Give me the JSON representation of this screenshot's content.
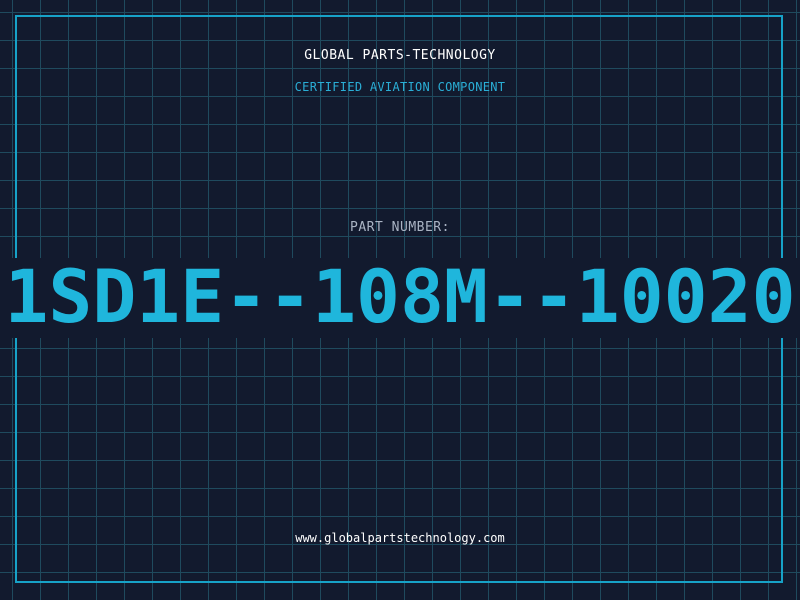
{
  "header": {
    "company": "GLOBAL PARTS-TECHNOLOGY",
    "tagline": "CERTIFIED AVIATION COMPONENT"
  },
  "part": {
    "label": "PART NUMBER:",
    "number": "1SD1E--108M--10020"
  },
  "footer": {
    "website": "www.globalpartstechnology.com"
  },
  "colors": {
    "background": "#121a2e",
    "grid": "#1f4a5e",
    "accent": "#1fb6dc",
    "frame": "#17a2c8"
  }
}
